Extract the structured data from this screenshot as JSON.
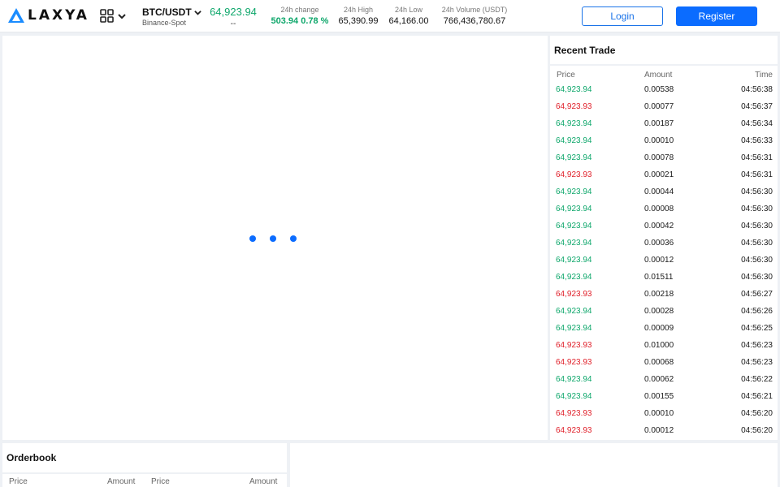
{
  "brand": {
    "name": "LAXYA"
  },
  "pair": {
    "name": "BTC/USDT",
    "source": "Binance-Spot"
  },
  "ticker": {
    "last_price": "64,923.94",
    "last_price_sub": "--",
    "change_label": "24h change",
    "change_value": "503.94 0.78 %",
    "high_label": "24h High",
    "high_value": "65,390.99",
    "low_label": "24h Low",
    "low_value": "64,166.00",
    "volume_label": "24h Volume (USDT)",
    "volume_value": "766,436,780.67"
  },
  "auth": {
    "login_label": "Login",
    "register_label": "Register"
  },
  "colors": {
    "up": "#0ea76b",
    "down": "#e0202a",
    "accent": "#0b6cff"
  },
  "recent_trade": {
    "title": "Recent Trade",
    "headers": {
      "price": "Price",
      "amount": "Amount",
      "time": "Time"
    },
    "rows": [
      {
        "price": "64,923.94",
        "amount": "0.00538",
        "time": "04:56:38",
        "side": "up"
      },
      {
        "price": "64,923.93",
        "amount": "0.00077",
        "time": "04:56:37",
        "side": "down"
      },
      {
        "price": "64,923.94",
        "amount": "0.00187",
        "time": "04:56:34",
        "side": "up"
      },
      {
        "price": "64,923.94",
        "amount": "0.00010",
        "time": "04:56:33",
        "side": "up"
      },
      {
        "price": "64,923.94",
        "amount": "0.00078",
        "time": "04:56:31",
        "side": "up"
      },
      {
        "price": "64,923.93",
        "amount": "0.00021",
        "time": "04:56:31",
        "side": "down"
      },
      {
        "price": "64,923.94",
        "amount": "0.00044",
        "time": "04:56:30",
        "side": "up"
      },
      {
        "price": "64,923.94",
        "amount": "0.00008",
        "time": "04:56:30",
        "side": "up"
      },
      {
        "price": "64,923.94",
        "amount": "0.00042",
        "time": "04:56:30",
        "side": "up"
      },
      {
        "price": "64,923.94",
        "amount": "0.00036",
        "time": "04:56:30",
        "side": "up"
      },
      {
        "price": "64,923.94",
        "amount": "0.00012",
        "time": "04:56:30",
        "side": "up"
      },
      {
        "price": "64,923.94",
        "amount": "0.01511",
        "time": "04:56:30",
        "side": "up"
      },
      {
        "price": "64,923.93",
        "amount": "0.00218",
        "time": "04:56:27",
        "side": "down"
      },
      {
        "price": "64,923.94",
        "amount": "0.00028",
        "time": "04:56:26",
        "side": "up"
      },
      {
        "price": "64,923.94",
        "amount": "0.00009",
        "time": "04:56:25",
        "side": "up"
      },
      {
        "price": "64,923.93",
        "amount": "0.01000",
        "time": "04:56:23",
        "side": "down"
      },
      {
        "price": "64,923.93",
        "amount": "0.00068",
        "time": "04:56:23",
        "side": "down"
      },
      {
        "price": "64,923.94",
        "amount": "0.00062",
        "time": "04:56:22",
        "side": "up"
      },
      {
        "price": "64,923.94",
        "amount": "0.00155",
        "time": "04:56:21",
        "side": "up"
      },
      {
        "price": "64,923.93",
        "amount": "0.00010",
        "time": "04:56:20",
        "side": "down"
      },
      {
        "price": "64,923.93",
        "amount": "0.00012",
        "time": "04:56:20",
        "side": "down"
      }
    ]
  },
  "orderbook": {
    "title": "Orderbook",
    "headers": {
      "bid_price": "Price",
      "bid_amount": "Amount",
      "ask_price": "Price",
      "ask_amount": "Amount"
    }
  }
}
